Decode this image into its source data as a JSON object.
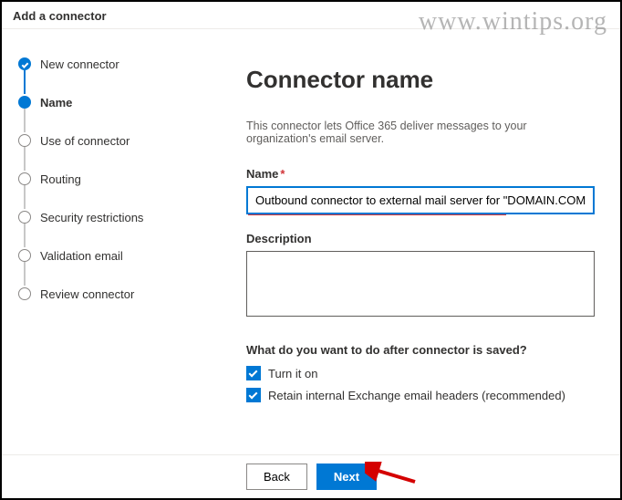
{
  "header": {
    "title": "Add a connector"
  },
  "watermark": "www.wintips.org",
  "sidebar": {
    "steps": [
      {
        "label": "New connector",
        "state": "completed"
      },
      {
        "label": "Name",
        "state": "current"
      },
      {
        "label": "Use of connector",
        "state": "upcoming"
      },
      {
        "label": "Routing",
        "state": "upcoming"
      },
      {
        "label": "Security restrictions",
        "state": "upcoming"
      },
      {
        "label": "Validation email",
        "state": "upcoming"
      },
      {
        "label": "Review connector",
        "state": "upcoming"
      }
    ]
  },
  "main": {
    "title": "Connector name",
    "intro": "This connector lets Office 365 deliver messages to your organization's email server.",
    "name_label": "Name",
    "name_required": "*",
    "name_value": "Outbound connector to external mail server for \"DOMAIN.COM\"",
    "description_label": "Description",
    "description_value": "",
    "after_save_question": "What do you want to do after connector is saved?",
    "checkbox1_label": "Turn it on",
    "checkbox1_checked": true,
    "checkbox2_label": "Retain internal Exchange email headers (recommended)",
    "checkbox2_checked": true
  },
  "footer": {
    "back_label": "Back",
    "next_label": "Next"
  }
}
